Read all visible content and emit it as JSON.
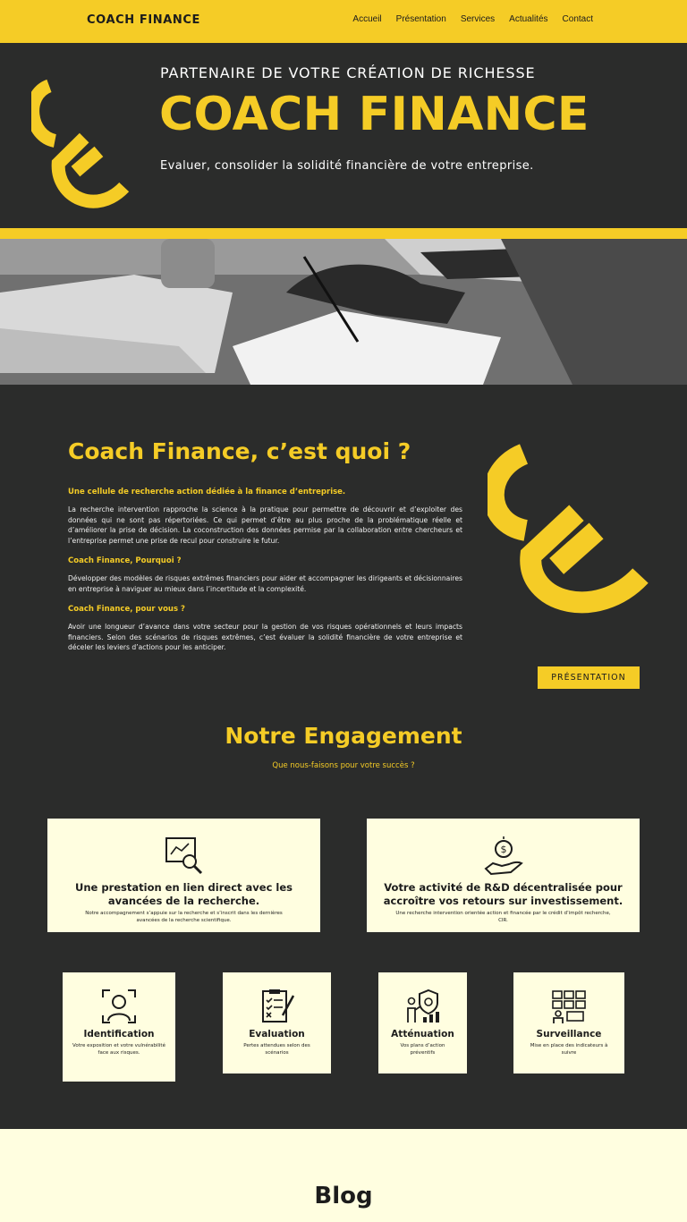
{
  "header": {
    "brand": "COACH FINANCE",
    "nav": [
      "Accueil",
      "Présentation",
      "Services",
      "Actualités",
      "Contact"
    ]
  },
  "hero": {
    "tagline": "PARTENAIRE DE VOTRE CRÉATION DE RICHESSE",
    "title": "COACH FINANCE",
    "subtitle": "Evaluer, consolider la solidité financière de votre entreprise."
  },
  "about": {
    "title": "Coach Finance, c’est quoi ?",
    "heading1": "Une cellule de recherche action dédiée à la finance d’entreprise.",
    "para1": "La recherche intervention rapproche la science à la pratique pour permettre de découvrir et d’exploiter des données qui ne sont pas répertoriées. Ce qui permet d’être au plus proche de la problématique réelle et d’améliorer la prise de décision. La coconstruction des données permise par la collaboration entre chercheurs et l’entreprise permet une prise de recul pour construire le futur.",
    "heading2": "Coach Finance, Pourquoi ?",
    "para2": "Développer des modèles de risques extrêmes financiers pour aider et accompagner les dirigeants et décisionnaires en entreprise à naviguer au mieux dans l’incertitude et la complexité.",
    "heading3": "Coach Finance, pour vous ?",
    "para3": "Avoir une longueur d’avance dans votre secteur pour la gestion de vos risques opérationnels et leurs impacts financiers. Selon des scénarios de risques extrêmes, c’est évaluer la solidité financière de votre entreprise et déceler les leviers d’actions pour les anticiper.",
    "button": "PRÉSENTATION"
  },
  "engagement": {
    "title": "Notre Engagement",
    "subtitle": "Que nous-faisons pour votre succès ?",
    "big_cards": [
      {
        "icon": "research-chart-magnifier-icon",
        "title": "Une prestation en lien direct avec les avancées de la recherche.",
        "text": "Notre accompagnement s’appuie sur la recherche et s’inscrit dans les dernières avancées de la recherche scientifique."
      },
      {
        "icon": "hand-coin-icon",
        "title": "Votre activité de R&D décentralisée pour accroître vos retours sur investissement.",
        "text": "Une recherche intervention orientée action et financée par le crédit d’impôt recherche, CIR."
      }
    ],
    "small_cards": [
      {
        "icon": "face-scan-icon",
        "title": "Identification",
        "text": "Votre exposition et votre vulnérabilité face aux risques."
      },
      {
        "icon": "clipboard-checklist-icon",
        "title": "Evaluation",
        "text": "Pertes attendues selon des scénarios"
      },
      {
        "icon": "shield-presenter-icon",
        "title": "Atténuation",
        "text": "Vos plans d’action préventifs"
      },
      {
        "icon": "monitoring-dashboard-icon",
        "title": "Surveillance",
        "text": "Mise en place des indicateurs à suivre"
      }
    ]
  },
  "blog": {
    "title": "Blog"
  },
  "colors": {
    "accent": "#f5cc26",
    "background": "#2b2c2b",
    "card": "#fffee0"
  }
}
